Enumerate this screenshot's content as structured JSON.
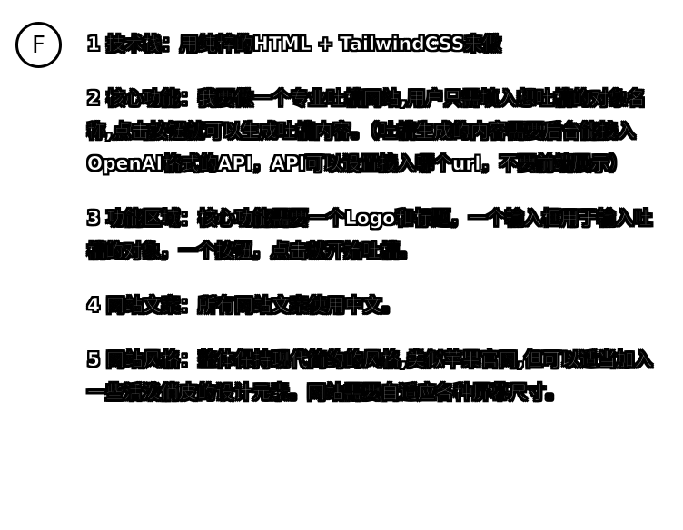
{
  "avatar": {
    "initial": "F"
  },
  "message": {
    "paragraphs": [
      "1 技术栈：用纯粹的HTML + TailwindCSS来做",
      "2 核心功能：我要做一个专业吐槽网站,用户只需填入想吐槽的对象名称,点击按钮就可以生成吐槽内容。（吐槽生成的内容需要后台能接入OpenAI格式的API，API可以设置接入哪个url，不要前端展示）",
      "3 功能区域：核心功能需要一个Logo和标题，一个输入框用于输入吐槽的对象，一个按钮，点击就开始吐槽。",
      "4 网站文案：所有网站文案使用中文。",
      "5 网站风格：整体保持现代简约的风格,类似苹果官网,但可以适当加入一些活泼俏皮的设计元素。网站需要自适应各种屏幕尺寸。"
    ]
  }
}
